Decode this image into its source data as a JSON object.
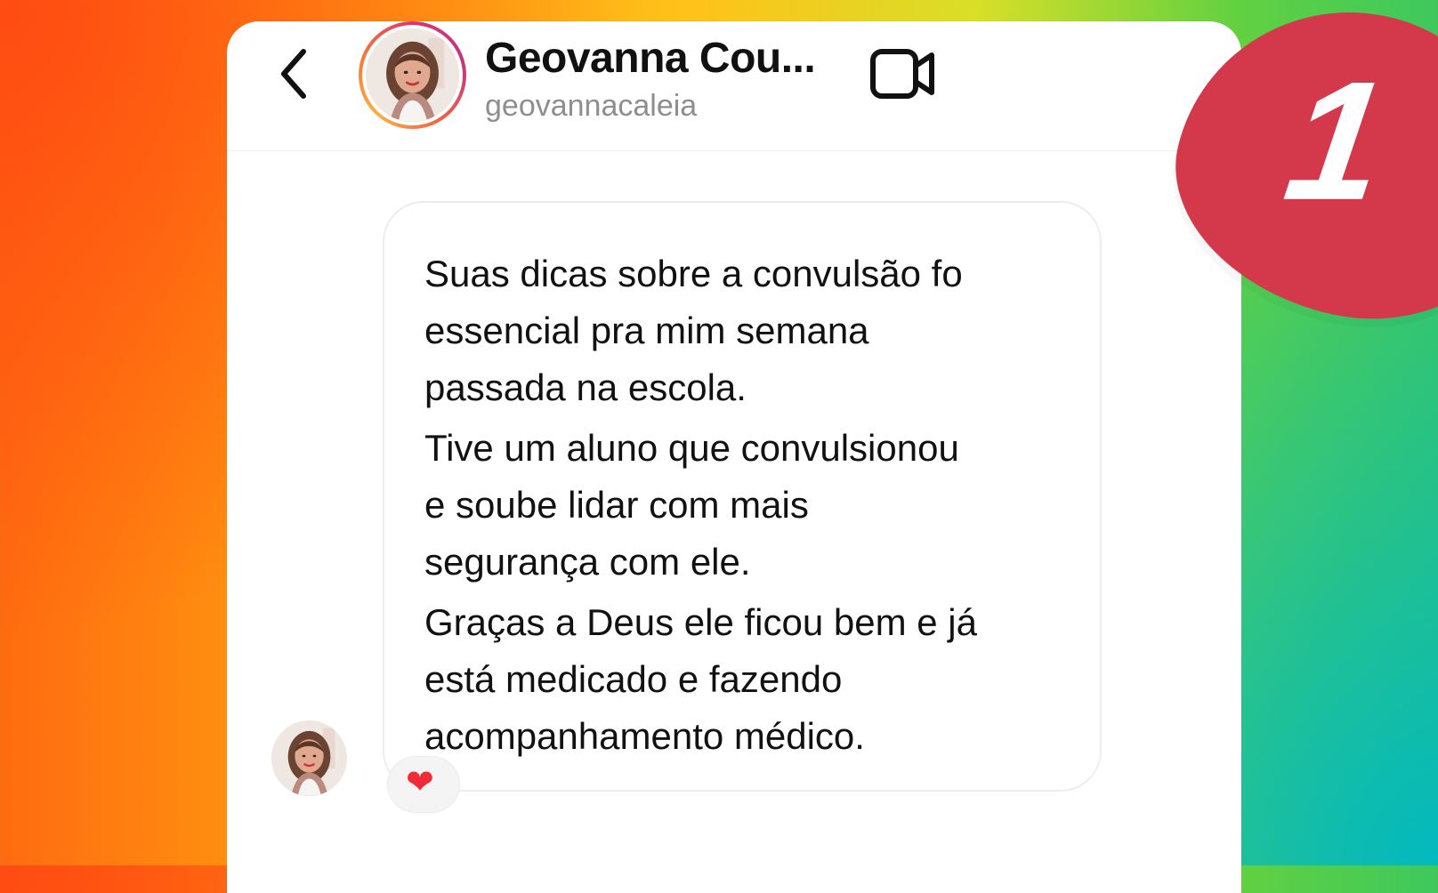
{
  "chat": {
    "contact": {
      "name": "Geovanna Cou...",
      "handle": "geovannacaleia"
    },
    "icons": {
      "back": "back-chevron-icon",
      "video": "video-call-icon",
      "avatar": "profile-photo",
      "reaction": "heart-icon"
    },
    "message": {
      "lines": [
        "Suas dicas sobre a convulsão fo",
        "essencial pra mim semana",
        "passada na escola.",
        "Tive um aluno que convulsionou",
        "e soube lidar com mais",
        "segurança com ele.",
        "Graças a Deus ele ficou bem e já",
        "está medicado e fazendo",
        "acompanhamento médico."
      ]
    },
    "reaction": {
      "emoji": "❤"
    }
  },
  "overlay": {
    "badge_number": "1"
  },
  "colors": {
    "badge": "#d3384b",
    "text": "#111111",
    "muted": "#8e8e8e"
  }
}
